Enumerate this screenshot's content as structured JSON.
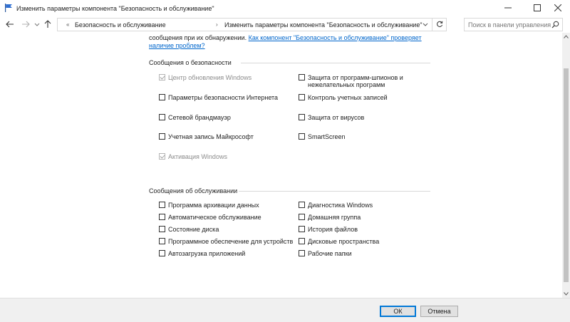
{
  "window": {
    "title": "Изменить параметры компонента \"Безопасность и обслуживание\"",
    "icon": "flag-icon",
    "controls": [
      "minimize-icon",
      "maximize-icon",
      "close-icon"
    ]
  },
  "nav": {
    "breadcrumb_lead": "«",
    "breadcrumb": [
      "Безопасность и обслуживание",
      "Изменить параметры компонента \"Безопасность и обслуживание\""
    ],
    "breadcrumb_sep": "›",
    "search_placeholder": "Поиск в панели управления"
  },
  "intro": {
    "text": "сообщения при их обнаружении. ",
    "link": "Как компонент \"Безопасность и обслуживание\" проверяет наличие проблем?"
  },
  "security": {
    "title": "Сообщения о безопасности",
    "left": [
      {
        "label": "Центр обновления Windows",
        "checked": true,
        "disabled": true
      },
      {
        "label": "Параметры безопасности Интернета",
        "checked": false,
        "disabled": false
      },
      {
        "label": "Сетевой брандмауэр",
        "checked": false,
        "disabled": false
      },
      {
        "label": "Учетная запись Майкрософт",
        "checked": false,
        "disabled": false
      },
      {
        "label": "Активация Windows",
        "checked": true,
        "disabled": true
      }
    ],
    "right": [
      {
        "label": "Защита от программ-шпионов и",
        "label2": "нежелательных программ",
        "checked": false
      },
      {
        "label": "Контроль учетных записей",
        "checked": false
      },
      {
        "label": "Защита от вирусов",
        "checked": false
      },
      {
        "label": "SmartScreen",
        "checked": false
      }
    ]
  },
  "maintenance": {
    "title": "Сообщения об обслуживании",
    "left": [
      {
        "label": "Программа архивации данных"
      },
      {
        "label": "Автоматическое обслуживание"
      },
      {
        "label": "Состояние диска"
      },
      {
        "label": "Программное обеспечение для устройств"
      },
      {
        "label": "Автозагрузка приложений"
      }
    ],
    "right": [
      {
        "label": "Диагностика Windows"
      },
      {
        "label": "Домашняя группа"
      },
      {
        "label": "История файлов"
      },
      {
        "label": "Дисковые пространства"
      },
      {
        "label": "Рабочие папки"
      }
    ]
  },
  "footer": {
    "ok": "ОК",
    "cancel": "Отмена"
  },
  "colors": {
    "link": "#0066cc",
    "accent": "#0078d7",
    "footer_bg": "#f0f0f0"
  }
}
